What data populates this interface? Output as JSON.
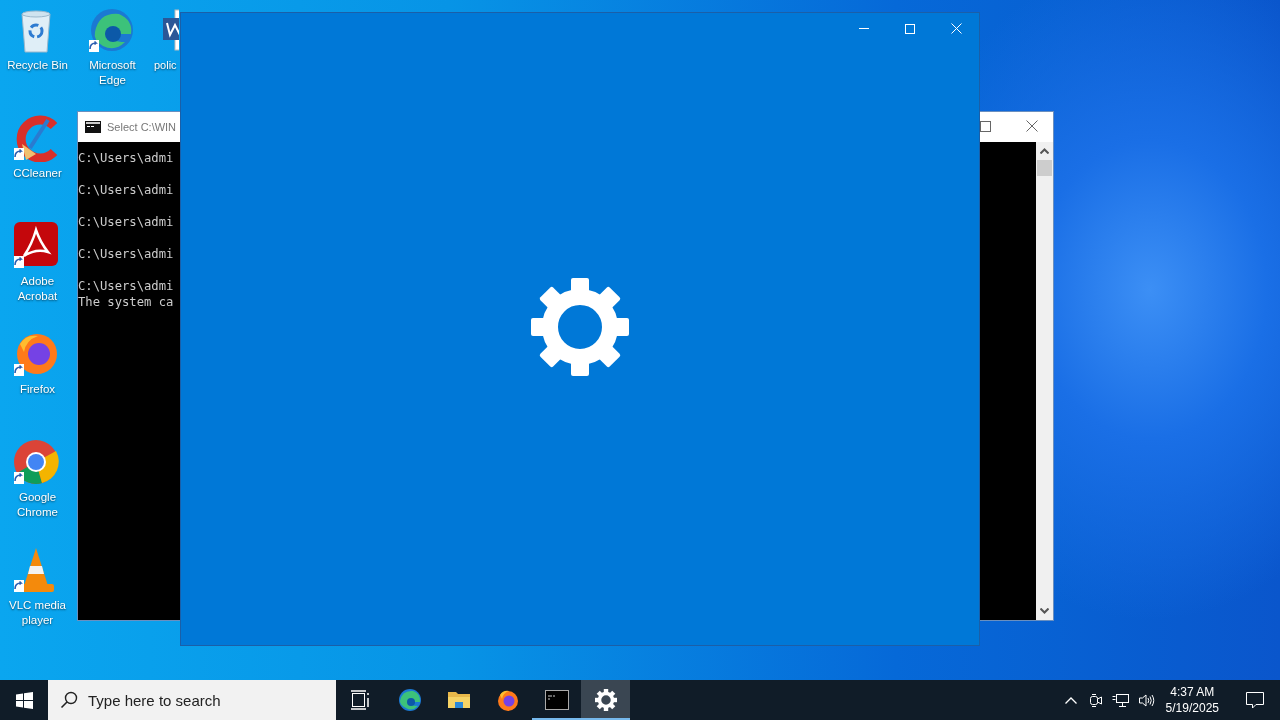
{
  "desktop": {
    "icon_columns": [
      [
        {
          "kind": "recycle-bin",
          "label": "Recycle Bin"
        },
        {
          "kind": "ccleaner",
          "label": "CCleaner"
        },
        {
          "kind": "acrobat",
          "label": "Adobe Acrobat"
        },
        {
          "kind": "firefox",
          "label": "Firefox"
        },
        {
          "kind": "chrome",
          "label": "Google Chrome"
        },
        {
          "kind": "vlc",
          "label": "VLC media player"
        }
      ],
      [
        {
          "kind": "edge",
          "label": "Microsoft Edge"
        }
      ],
      [
        {
          "kind": "word",
          "label": "polic"
        }
      ]
    ]
  },
  "console_window": {
    "title": "Select C:\\WIN",
    "lines": [
      {
        "kind": "prompt",
        "text": "C:\\Users\\admi"
      },
      {
        "kind": "prompt",
        "text": "C:\\Users\\admi"
      },
      {
        "kind": "prompt",
        "text": "C:\\Users\\admi"
      },
      {
        "kind": "prompt",
        "text": "C:\\Users\\admi"
      },
      {
        "kind": "prompt",
        "text": "C:\\Users\\admi"
      },
      {
        "kind": "output",
        "text": "The system ca"
      }
    ]
  },
  "settings_window": {
    "kind": "splash"
  },
  "taskbar": {
    "search": {
      "placeholder": "Type here to search"
    },
    "apps": [
      {
        "kind": "task-view",
        "running": false,
        "selected": false
      },
      {
        "kind": "edge",
        "running": false,
        "selected": false
      },
      {
        "kind": "explorer",
        "running": false,
        "selected": false
      },
      {
        "kind": "firefox",
        "running": false,
        "selected": false
      },
      {
        "kind": "console",
        "running": true,
        "selected": false
      },
      {
        "kind": "settings",
        "running": true,
        "selected": true
      }
    ],
    "time": "4:37 AM",
    "date": "5/19/2025"
  }
}
